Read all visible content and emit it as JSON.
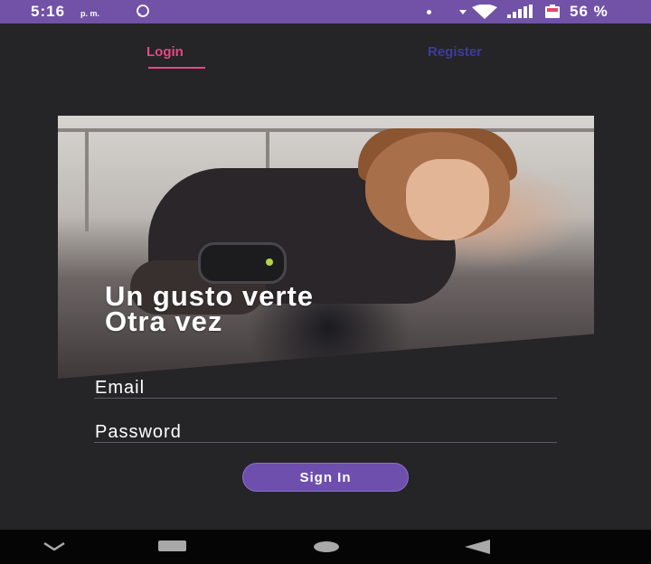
{
  "status_bar": {
    "time": "5:16",
    "ampm": "p. m.",
    "battery_percent": "56 %",
    "icons": [
      "whatsapp-icon",
      "dot-icon",
      "dnd-icon",
      "wifi-icon",
      "signal-icon",
      "battery-icon"
    ]
  },
  "tabs": [
    {
      "label": "Login",
      "active": true
    },
    {
      "label": "Register",
      "active": false
    }
  ],
  "hero": {
    "line1": "Un gusto verte",
    "line2": "Otra vez"
  },
  "form": {
    "email_label": "Email",
    "password_label": "Password",
    "submit_label": "Sign In"
  },
  "nav_bar": {
    "icons": [
      "nav-down-icon",
      "recents-icon",
      "home-icon",
      "back-icon"
    ]
  },
  "colors": {
    "status_bar": "#7152a6",
    "background": "#252427",
    "tab_active": "#e54a83",
    "tab_inactive": "#3e3d9c",
    "button": "#6e4fae"
  }
}
